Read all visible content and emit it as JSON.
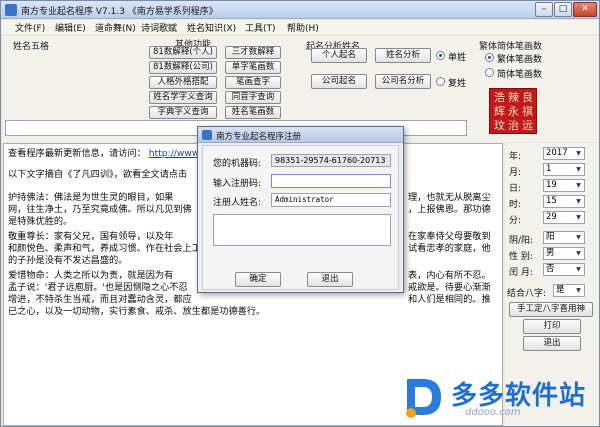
{
  "window": {
    "title": "南方专业起名程序 V7.1.3  《南方易学系列程序》"
  },
  "menu": [
    "文件(F)",
    "编辑(E)",
    "道命舞(N)",
    "诗词歌赋",
    "姓名知识(X)",
    "工具(T)",
    "帮助(H)"
  ],
  "surname_group": {
    "label": "姓名五格"
  },
  "functions": {
    "label": "其他功能",
    "buttons": [
      "81数解释(个人)",
      "三才数解释",
      "81数解释(公司)",
      "单字笔画数",
      "人格外格搭配",
      "笔画查字",
      "姓名学字义查询",
      "同音字查询",
      "字典字义查询",
      "姓名笔画数"
    ]
  },
  "analysis": {
    "label": "起名分析姓名",
    "buttons": [
      "个人起名",
      "姓名分析",
      "公司起名",
      "公司名分析"
    ],
    "mode_single": "单姓",
    "mode_double": "复姓"
  },
  "script_mode": {
    "label": "繁体简体笔画数",
    "traditional": "繁体笔画数",
    "simplified": "简体笔画数"
  },
  "seal": {
    "chars": [
      "浩",
      "辣",
      "良",
      "辉",
      "永",
      "祺",
      "玟",
      "治",
      "远"
    ]
  },
  "content": {
    "lines": [
      "查看程序最新更新信息，请访问：",
      "以下文字摘自《了凡四训》，欲看全文请点击",
      "    护持佛法：佛法是为世生灵的眼目，如果",
      "网，往生净土，乃至究竟成佛。所以凡见到佛",
      "是特殊优胜的。",
      "    敬重尊长：家有父兄，国有领导，以及年",
      "和颜悦色、柔声和气，养成习惯。作在社会上工",
      "的子孙是没有不发达昌盛的。",
      "    爱惜物命：人类之所以为贵，就是因为有",
      "孟子说：'君子远庖厨。'也是因恻隐之心不忍",
      "增进，不特杀生当戒，而且对蠢动含灵，都应",
      "已之心，以及一切动物，实行素食、戒杀、放生都是功德善行。"
    ],
    "right_fragments": [
      "理，也就无从脱离尘",
      "，上报佛恩。那功德",
      "在家奉侍父母要敬到",
      "试看忠孝的家庭，他",
      "表，内心有所不忍。",
      "戒欲是。待要心渐渐",
      "和人们是相同的。推"
    ],
    "link": "http://www"
  },
  "birth": {
    "year": {
      "label": "年:",
      "value": "2017"
    },
    "month": {
      "label": "月:",
      "value": "1"
    },
    "day": {
      "label": "日:",
      "value": "19"
    },
    "hour": {
      "label": "时:",
      "value": "15"
    },
    "minute": {
      "label": "分:",
      "value": "29"
    },
    "calendar": {
      "label": "阴/阳:",
      "value": "阳"
    },
    "gender": {
      "label": "性 别:",
      "value": "男"
    },
    "leap": {
      "label": "闰 月:",
      "value": "否"
    },
    "bazi": {
      "label": "结合八字:",
      "value": "是"
    }
  },
  "right_buttons": {
    "manual_bazi": "手工定八字喜用神",
    "print": "打印",
    "exit": "退出"
  },
  "dialog": {
    "title": "南方专业起名程序注册",
    "machine_label": "您的机器码:",
    "machine_code": "98351-29574-61760-20713",
    "reg_code_label": "输入注册码:",
    "reg_code_value": "",
    "reg_name_label": "注册人姓名:",
    "reg_name_value": "Administrator",
    "ok": "确定",
    "exit": "退出"
  },
  "watermark": {
    "text": "多多软件站",
    "url": "ddooo.com"
  }
}
